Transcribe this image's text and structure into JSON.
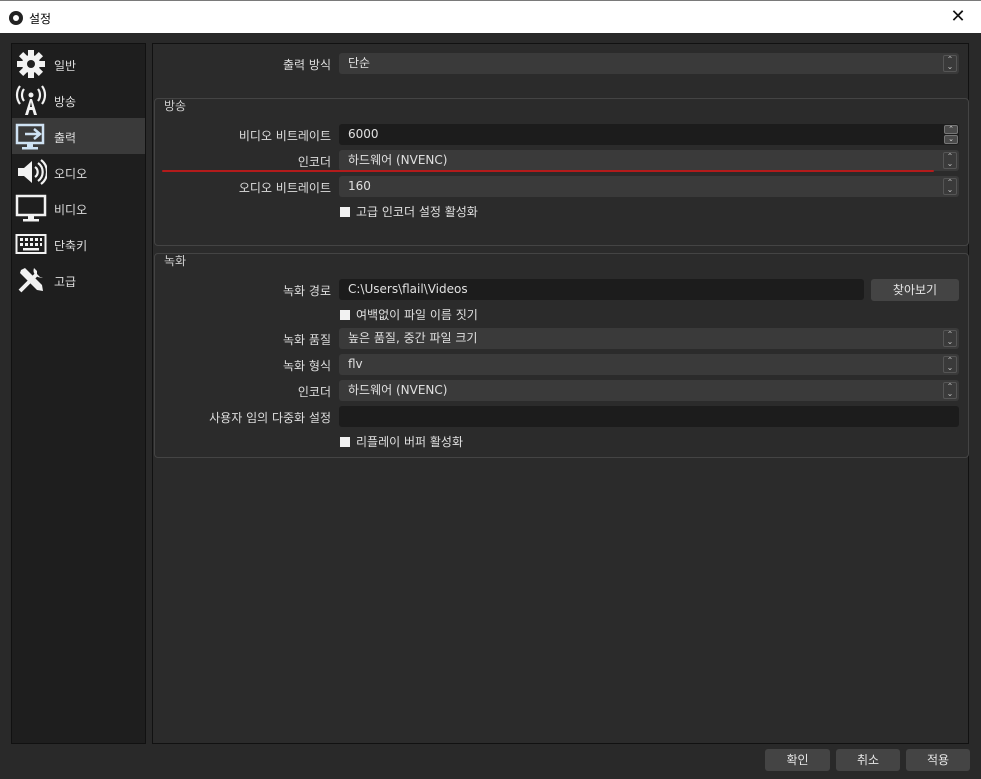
{
  "window": {
    "title": "설정",
    "close_glyph": "✕"
  },
  "sidebar": {
    "items": [
      {
        "label": "일반",
        "icon": "gear-icon"
      },
      {
        "label": "방송",
        "icon": "broadcast-antenna-icon"
      },
      {
        "label": "출력",
        "icon": "output-monitor-icon"
      },
      {
        "label": "오디오",
        "icon": "speaker-icon"
      },
      {
        "label": "비디오",
        "icon": "monitor-icon"
      },
      {
        "label": "단축키",
        "icon": "keyboard-icon"
      },
      {
        "label": "고급",
        "icon": "tools-icon"
      }
    ],
    "active_index": 2
  },
  "output_mode": {
    "label": "출력 방식",
    "value": "단순"
  },
  "streaming": {
    "title": "방송",
    "video_bitrate_label": "비디오 비트레이트",
    "video_bitrate_value": "6000",
    "encoder_label": "인코더",
    "encoder_value": "하드웨어 (NVENC)",
    "audio_bitrate_label": "오디오 비트레이트",
    "audio_bitrate_value": "160",
    "advanced_encoder_label": "고급 인코더 설정 활성화"
  },
  "recording": {
    "title": "녹화",
    "path_label": "녹화 경로",
    "path_value": "C:\\Users\\flail\\Videos",
    "browse_label": "찾아보기",
    "no_space_label": "여백없이 파일 이름 짓기",
    "quality_label": "녹화 품질",
    "quality_value": "높은 품질, 중간 파일 크기",
    "format_label": "녹화 형식",
    "format_value": "flv",
    "encoder_label": "인코더",
    "encoder_value": "하드웨어 (NVENC)",
    "muxer_label": "사용자 임의 다중화 설정",
    "muxer_value": "",
    "replay_buffer_label": "리플레이 버퍼 활성화"
  },
  "footer": {
    "ok_label": "확인",
    "cancel_label": "취소",
    "apply_label": "적용"
  },
  "colors": {
    "annotation_red": "#b31b1b",
    "active_item": "#3a3a3a"
  }
}
